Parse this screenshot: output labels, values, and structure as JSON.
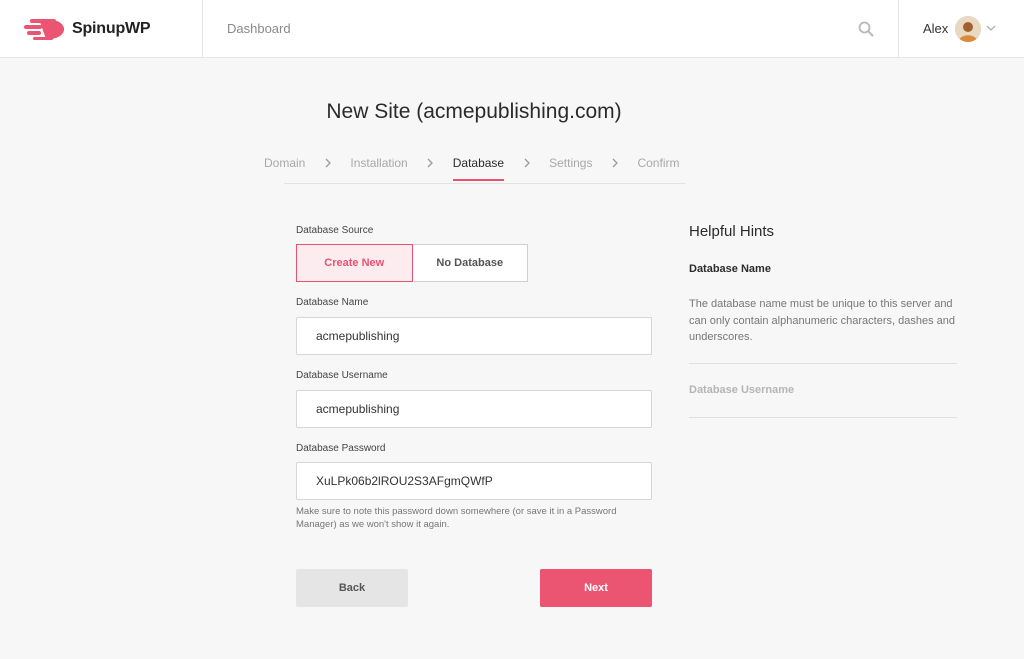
{
  "header": {
    "brand_name": "SpinupWP",
    "nav_dashboard": "Dashboard",
    "user_name": "Alex",
    "accent_color": "#e8536f"
  },
  "page": {
    "title": "New Site (acmepublishing.com)"
  },
  "steps": [
    {
      "label": "Domain",
      "state": "done"
    },
    {
      "label": "Installation",
      "state": "done"
    },
    {
      "label": "Database",
      "state": "active"
    },
    {
      "label": "Settings",
      "state": "upcoming"
    },
    {
      "label": "Confirm",
      "state": "upcoming"
    }
  ],
  "form": {
    "source_label": "Database Source",
    "source_options": [
      "Create New",
      "No Database"
    ],
    "source_selected": "Create New",
    "name_label": "Database Name",
    "name_value": "acmepublishing",
    "username_label": "Database Username",
    "username_value": "acmepublishing",
    "password_label": "Database Password",
    "password_value": "XuLPk06b2lROU2S3AFgmQWfP",
    "password_note": "Make sure to note this password down somewhere (or save it in a Password Manager) as we won't show it again.",
    "back_label": "Back",
    "next_label": "Next"
  },
  "hints": {
    "title": "Helpful Hints",
    "active_heading": "Database Name",
    "active_body": "The database name must be unique to this server and can only contain alphanumeric characters, dashes and underscores.",
    "collapsed_heading": "Database Username"
  }
}
